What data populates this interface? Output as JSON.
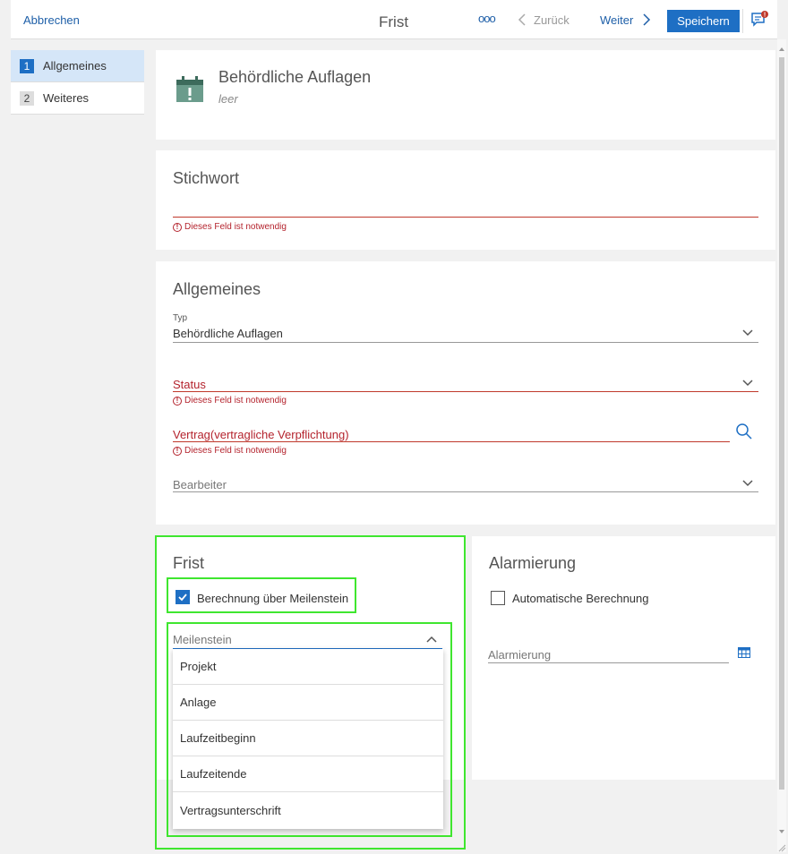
{
  "topbar": {
    "cancel": "Abbrechen",
    "title": "Frist",
    "more": "ooo",
    "back": "Zurück",
    "next": "Weiter",
    "save": "Speichern"
  },
  "nav": [
    {
      "num": "1",
      "label": "Allgemeines"
    },
    {
      "num": "2",
      "label": "Weiteres"
    }
  ],
  "header": {
    "title": "Behördliche Auflagen",
    "subtitle": "leer"
  },
  "stichwort": {
    "title": "Stichwort",
    "error": "Dieses Feld ist notwendig"
  },
  "allgemeines": {
    "title": "Allgemeines",
    "typ_label": "Typ",
    "typ_value": "Behördliche Auflagen",
    "status_label": "Status",
    "status_error": "Dieses Feld ist notwendig",
    "vertrag_label": "Vertrag(vertragliche Verpflichtung)",
    "vertrag_error": "Dieses Feld ist notwendig",
    "bearbeiter_label": "Bearbeiter"
  },
  "frist": {
    "title": "Frist",
    "checkbox_label": "Berechnung über Meilenstein",
    "checked": true,
    "meilenstein_label": "Meilenstein",
    "options": [
      "Projekt",
      "Anlage",
      "Laufzeitbeginn",
      "Laufzeitende",
      "Vertragsunterschrift"
    ]
  },
  "alarmierung": {
    "title": "Alarmierung",
    "checkbox_label": "Automatische Berechnung",
    "checked": false,
    "field_label": "Alarmierung"
  },
  "colors": {
    "accent": "#1e6fc4",
    "error": "#b4232d",
    "highlight": "#3fe62f"
  }
}
